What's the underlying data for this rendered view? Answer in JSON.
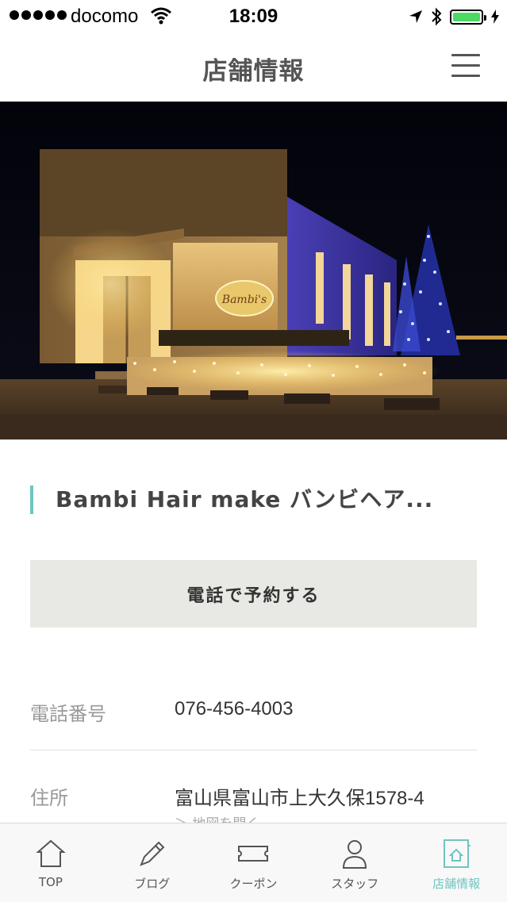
{
  "status_bar": {
    "carrier": "docomo",
    "time": "18:09"
  },
  "nav": {
    "title": "店舗情報"
  },
  "hero": {
    "sign_text": "Bambi's"
  },
  "shop": {
    "name": "Bambi Hair make バンビヘア..."
  },
  "call_button": {
    "label": "電話で予約する"
  },
  "info": {
    "phone_label": "電話番号",
    "phone_value": "076-456-4003",
    "address_label": "住所",
    "address_value": "富山県富山市上大久保1578-4",
    "map_link": "＞ 地図を開く"
  },
  "tabs": [
    {
      "label": "TOP",
      "icon": "home-icon"
    },
    {
      "label": "ブログ",
      "icon": "pencil-icon"
    },
    {
      "label": "クーポン",
      "icon": "ticket-icon"
    },
    {
      "label": "スタッフ",
      "icon": "person-icon"
    },
    {
      "label": "店舗情報",
      "icon": "shop-icon",
      "active": true
    }
  ],
  "colors": {
    "accent": "#6fc5c0",
    "battery": "#4cd964"
  }
}
